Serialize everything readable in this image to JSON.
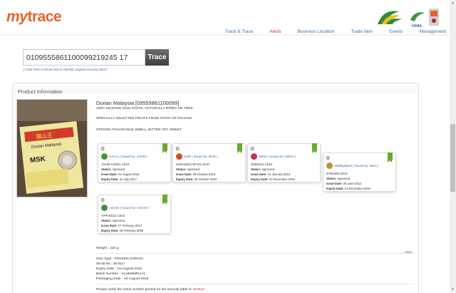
{
  "header": {
    "logo_my": "my",
    "logo_trace": "trace",
    "partner_logo_text": "FAMA",
    "nav": [
      {
        "label": "Track & Trace",
        "active": false
      },
      {
        "label": "Alerts",
        "active": true
      },
      {
        "label": "Business Location",
        "active": false
      },
      {
        "label": "Trade Item",
        "active": false
      },
      {
        "label": "Events",
        "active": false
      },
      {
        "label": "Management",
        "active": false
      }
    ]
  },
  "search": {
    "value": "0109555861100099219245 17",
    "button_label": "Trace",
    "help_link": "[ Click here to know how to identify original security label ]"
  },
  "product": {
    "section_title": "Product Information",
    "name": "Durian Malaysia [09555861100099]",
    "descriptions": [
      "100% MUSANG KING PASTE, NATURALLY RIPEN ON TREE",
      "SPECIALLY SELECTED FRUITS FROM STATE OF PAHANG",
      "STRONG FRAGRANCE SMELL, BITTER YET SWEET"
    ],
    "image_label_top": "猫山王",
    "image_label_brand": "Durian Malaysia",
    "image_label_code": "MSK"
  },
  "certifications": [
    {
      "title": "HALAL ( issued by: JAKIM )",
      "code": "JAKIM A15001 CE10",
      "status": "Approved",
      "issue": "01-August-2015",
      "expiry": "31-July-2017",
      "color": "#3c9a3c"
    },
    {
      "title": "GMP ( issued by: MOH )",
      "code": "KKM-183(17SP14) CE10",
      "status": "Approved",
      "issue": "30-October-2015",
      "expiry": "30-October-2019",
      "color": "#d04a2a"
    },
    {
      "title": "MEKA ( issued by: MEKA )",
      "code": "30382012 CE10",
      "status": "Approved",
      "issue": "01-January-2016",
      "expiry": "31-December-2019",
      "color": "#c8324a"
    },
    {
      "title": "HMallyaBeef ( issued by: MOA )",
      "code": "570019W CE10",
      "status": "Approved",
      "issue": "30-June-2012",
      "expiry": "31-December-2016",
      "color": "#b8932e"
    },
    {
      "title": "AOGIG ( issued by: AOGIG )",
      "code": "A/PF(04)12 CE10",
      "status": "Approved",
      "issue": "27-February-2013",
      "expiry": "26-February-2008",
      "color": "#3f8f4a"
    }
  ],
  "labels": {
    "status": "Status:",
    "issue_date": "Issue Date:",
    "expiry_date": "Expiry Date:"
  },
  "details": {
    "weight": "Weight : 220 g",
    "item_type": "Item Type : FROZEN DURIAN",
    "serial": "Serial No : 924517",
    "expiry": "Expiry Date : 15-August-2018",
    "batch": "Batch Number : AL1606MP(1A)",
    "packaging": "Packaging Date : 16-August-2016",
    "hide_link": "... Hide"
  },
  "verify": {
    "text": "Please verify the serial number printed on the security label is: ",
    "serial": "924517"
  }
}
